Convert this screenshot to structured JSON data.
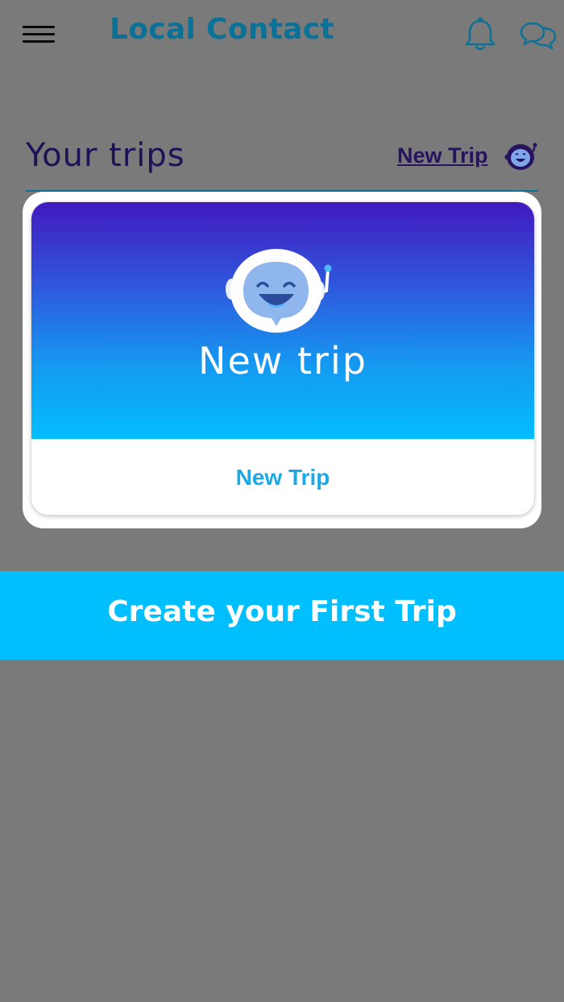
{
  "header": {
    "title": "Local Contact",
    "menu_icon": "hamburger-menu-icon",
    "notification_icon": "bell-icon",
    "chat_icon": "chat-bubbles-icon"
  },
  "trips_section": {
    "title": "Your trips",
    "new_trip_link": "New Trip",
    "new_trip_icon": "robot-mascot-icon"
  },
  "trip_card": {
    "banner_title": "New trip",
    "footer_label": "New Trip",
    "mascot_icon": "robot-mascot-icon"
  },
  "cta": {
    "label": "Create your First Trip"
  },
  "colors": {
    "page_background": "#7a7a7a",
    "brand_title": "#0b7197",
    "section_title": "#1d1256",
    "link": "#27135f",
    "card_label": "#1ba9e8",
    "cta_background": "#00bfff",
    "banner_top": "#4219bf",
    "banner_bottom": "#03bdfd"
  }
}
